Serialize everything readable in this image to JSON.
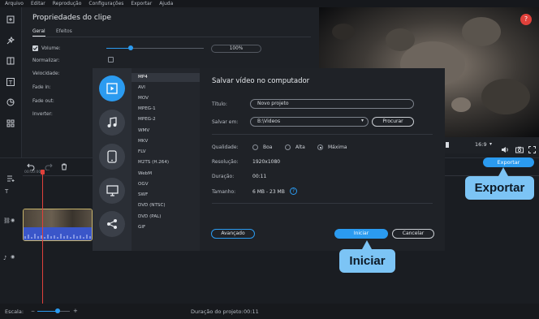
{
  "menu": [
    "Arquivo",
    "Editar",
    "Reprodução",
    "Configurações",
    "Exportar",
    "Ajuda"
  ],
  "left_tools": [
    "import-icon",
    "effects-icon",
    "transitions-icon",
    "titles-icon",
    "stickers-icon",
    "more-tools-icon"
  ],
  "props": {
    "title": "Propriedades do clipe",
    "tabs": [
      "Geral",
      "Efeitos"
    ],
    "volume_label": "Volume:",
    "volume_value": "100%",
    "normalize_label": "Normalizar:",
    "speed_label": "Velocidade:",
    "fadein_label": "Fade in:",
    "fadeout_label": "Fade out:",
    "invert_label": "Inverter:"
  },
  "preview": {
    "aspect": "16:9",
    "help": "?"
  },
  "export_button": "Exportar",
  "callouts": {
    "export": "Exportar",
    "start": "Iniciar"
  },
  "timeline": {
    "ruler_start": "00:00:00"
  },
  "modal": {
    "title": "Salvar vídeo no computador",
    "categories": [
      "video-file-icon",
      "audio-file-icon",
      "mobile-device-icon",
      "tv-icon",
      "share-icon"
    ],
    "formats": [
      "MP4",
      "AVI",
      "MOV",
      "MPEG-1",
      "MPEG-2",
      "WMV",
      "MKV",
      "FLV",
      "M2TS (H.264)",
      "WebM",
      "OGV",
      "SWF",
      "DVD (NTSC)",
      "DVD (PAL)",
      "GIF"
    ],
    "selected_format": "MP4",
    "title_label": "Título:",
    "title_value": "Novo projeto",
    "save_label": "Salvar em:",
    "save_value": "B:\\Videos",
    "browse_button": "Procurar",
    "quality_label": "Qualidade:",
    "quality_options": [
      "Boa",
      "Alta",
      "Máxima"
    ],
    "quality_selected": "Máxima",
    "resolution_label": "Resolução:",
    "resolution_value": "1920x1080",
    "duration_label": "Duração:",
    "duration_value": "00:11",
    "size_label": "Tamanho:",
    "size_value": "6 MB - 23 MB",
    "advanced_button": "Avançado",
    "start_button": "Iniciar",
    "cancel_button": "Cancelar"
  },
  "footer": {
    "scale_label": "Escala:",
    "project_duration_label": "Duração do projeto:",
    "project_duration_value": "00:11"
  },
  "colors": {
    "accent": "#2b9bf0",
    "callout": "#7cc4f5",
    "playhead": "#e0413b",
    "clip_audio": "#3a56c9"
  }
}
